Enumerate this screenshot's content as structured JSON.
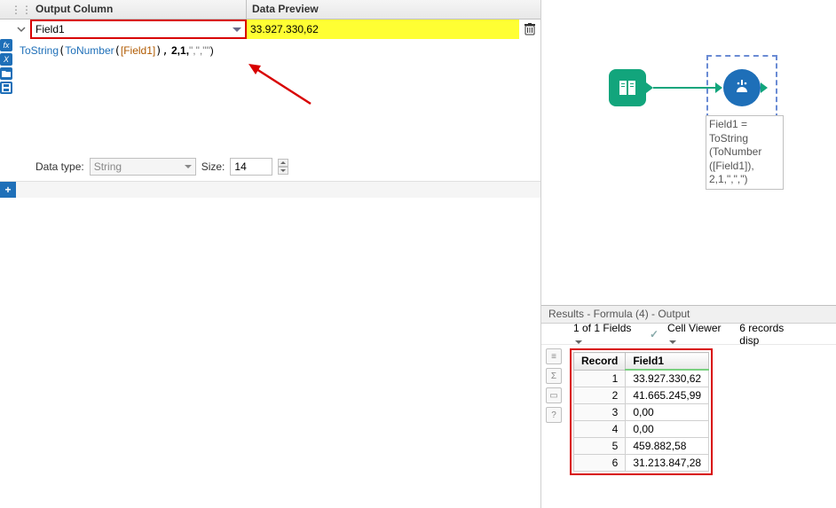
{
  "header": {
    "output_col": "Output Column",
    "data_preview": "Data Preview"
  },
  "field_select": {
    "value": "Field1"
  },
  "preview_value": "33.927.330,62",
  "formula": {
    "fn1": "ToString",
    "fn2": "ToNumber",
    "field_ref": "[Field1]",
    "args_tail": " 2,1,",
    "str_args": "\",\",\"\"",
    "close": ")"
  },
  "typerow": {
    "label_type": "Data type:",
    "type_value": "String",
    "label_size": "Size:",
    "size_value": "14"
  },
  "canvas": {
    "annotation": "Field1 = ToString\n(ToNumber\n([Field1]), 2,1,\",\",\")"
  },
  "results": {
    "title": "Results - Formula (4) - Output",
    "fields_count": "1 of 1 Fields",
    "cell_viewer": "Cell Viewer",
    "records_info": "6 records disp",
    "columns": {
      "record": "Record",
      "field1": "Field1"
    },
    "rows": [
      {
        "rec": "1",
        "val": "33.927.330,62"
      },
      {
        "rec": "2",
        "val": "41.665.245,99"
      },
      {
        "rec": "3",
        "val": "0,00"
      },
      {
        "rec": "4",
        "val": "0,00"
      },
      {
        "rec": "5",
        "val": "459.882,58"
      },
      {
        "rec": "6",
        "val": "31.213.847,28"
      }
    ]
  }
}
